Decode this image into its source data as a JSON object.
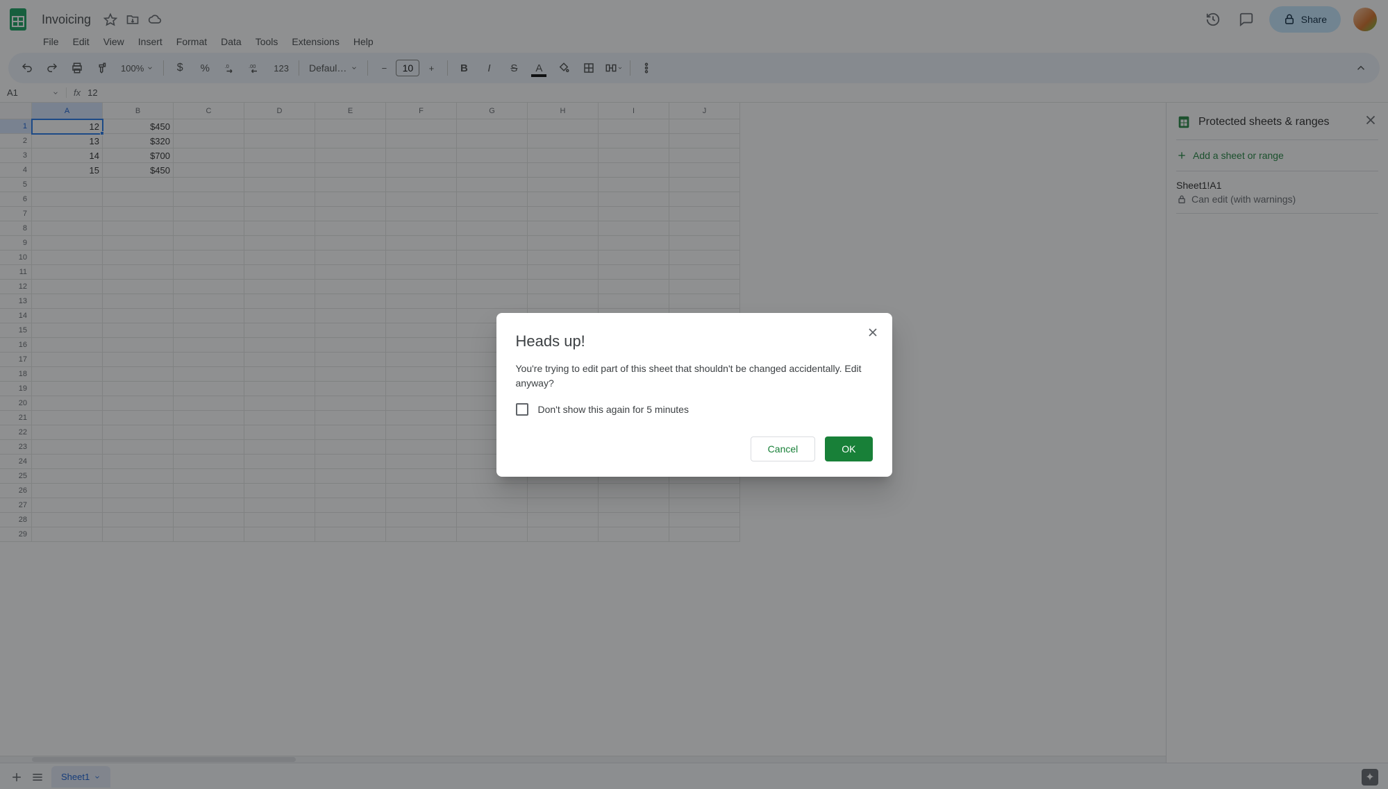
{
  "doc": {
    "title": "Invoicing"
  },
  "menus": [
    "File",
    "Edit",
    "View",
    "Insert",
    "Format",
    "Data",
    "Tools",
    "Extensions",
    "Help"
  ],
  "toolbar": {
    "zoom": "100%",
    "font": "Defaul…",
    "fontsize": "10",
    "format123": "123"
  },
  "share_label": "Share",
  "name_box": "A1",
  "formula_value": "12",
  "columns": [
    "A",
    "B",
    "C",
    "D",
    "E",
    "F",
    "G",
    "H",
    "I",
    "J"
  ],
  "row_count": 29,
  "cells": {
    "r1": {
      "A": "12",
      "B": "$450"
    },
    "r2": {
      "A": "13",
      "B": "$320"
    },
    "r3": {
      "A": "14",
      "B": "$700"
    },
    "r4": {
      "A": "15",
      "B": "$450"
    }
  },
  "chart_data": {
    "type": "table",
    "columns": [
      "A",
      "B"
    ],
    "rows": [
      [
        12,
        "$450"
      ],
      [
        13,
        "$320"
      ],
      [
        14,
        "$700"
      ],
      [
        15,
        "$450"
      ]
    ]
  },
  "side_panel": {
    "title": "Protected sheets & ranges",
    "add": "Add a sheet or range",
    "item_title": "Sheet1!A1",
    "item_sub": "Can edit (with warnings)"
  },
  "sheet_tab": "Sheet1",
  "dialog": {
    "title": "Heads up!",
    "body": "You're trying to edit part of this sheet that shouldn't be changed accidentally. Edit anyway?",
    "checkbox": "Don't show this again for 5 minutes",
    "cancel": "Cancel",
    "ok": "OK"
  }
}
